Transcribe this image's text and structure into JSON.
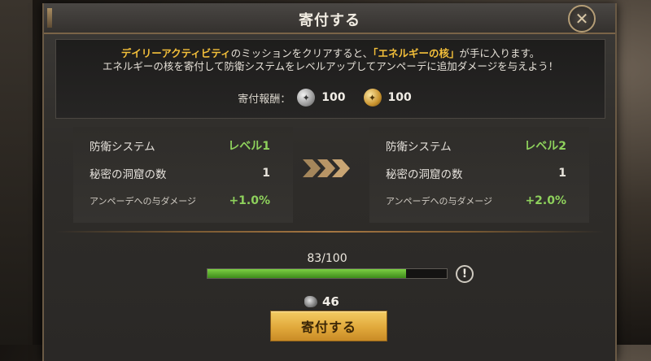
{
  "dialog": {
    "title": "寄付する"
  },
  "info": {
    "line1_hl1": "デイリーアクティビティ",
    "line1_mid": "のミッションをクリアすると、",
    "line1_hl2": "「エネルギーの核」",
    "line1_end": "が手に入ります。",
    "line2": "エネルギーの核を寄付して防衛システムをレベルアップしてアンペーデに追加ダメージを与えよう！",
    "reward_label": "寄付報酬：",
    "reward_silver": "100",
    "reward_gold": "100"
  },
  "current": {
    "system_label": "防衛システム",
    "system_value": "レベル1",
    "caves_label": "秘密の洞窟の数",
    "caves_value": "1",
    "damage_label": "アンペーデへの与ダメージ",
    "damage_value": "+1.0%"
  },
  "next": {
    "system_label": "防衛システム",
    "system_value": "レベル2",
    "caves_label": "秘密の洞窟の数",
    "caves_value": "1",
    "damage_label": "アンペーデへの与ダメージ",
    "damage_value": "+2.0%"
  },
  "progress": {
    "text": "83/100",
    "fraction": 0.83
  },
  "cost": {
    "amount": "46",
    "icon": "energy-core-ore-icon"
  },
  "button": {
    "label": "寄付する"
  },
  "colors": {
    "highlight": "#f3bf3a",
    "green": "#8ed15c",
    "button": "#e1a93b"
  }
}
